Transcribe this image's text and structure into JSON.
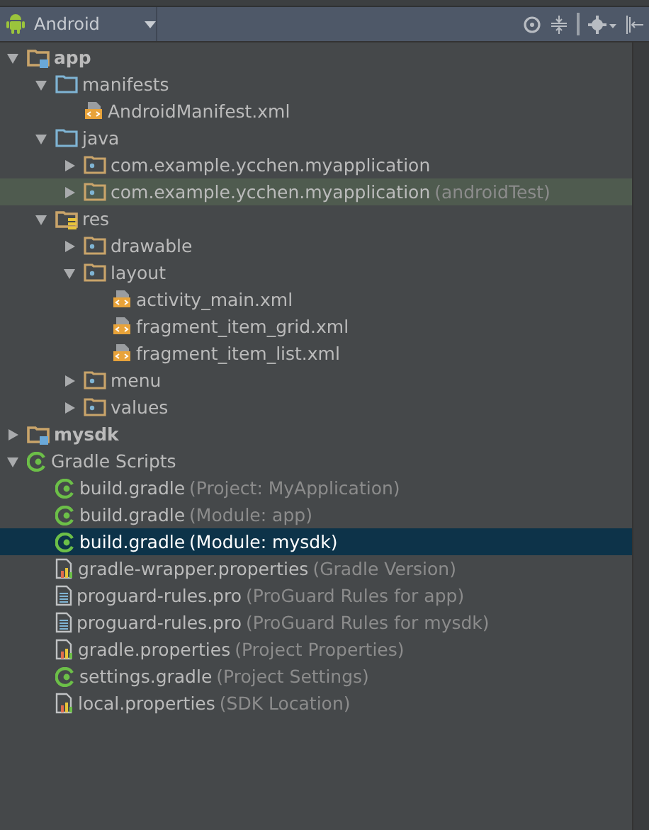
{
  "toolbar": {
    "view_label": "Android"
  },
  "tree": [
    {
      "kind": "module",
      "label": "app",
      "expanded": true,
      "selected": false,
      "highlighted": false,
      "children": [
        {
          "kind": "folder",
          "label": "manifests",
          "expanded": true,
          "selected": false,
          "highlighted": false,
          "children": [
            {
              "kind": "xml",
              "label": "AndroidManifest.xml",
              "selected": false,
              "highlighted": false
            }
          ]
        },
        {
          "kind": "folder",
          "label": "java",
          "expanded": true,
          "selected": false,
          "highlighted": false,
          "children": [
            {
              "kind": "package",
              "label": "com.example.ycchen.myapplication",
              "expanded": false,
              "selected": false,
              "highlighted": false
            },
            {
              "kind": "package",
              "label": "com.example.ycchen.myapplication",
              "note": "(androidTest)",
              "expanded": false,
              "selected": false,
              "highlighted": true
            }
          ]
        },
        {
          "kind": "resfolder",
          "label": "res",
          "expanded": true,
          "selected": false,
          "highlighted": false,
          "children": [
            {
              "kind": "package",
              "label": "drawable",
              "expanded": false,
              "selected": false,
              "highlighted": false
            },
            {
              "kind": "package",
              "label": "layout",
              "expanded": true,
              "selected": false,
              "highlighted": false,
              "children": [
                {
                  "kind": "xml",
                  "label": "activity_main.xml",
                  "selected": false,
                  "highlighted": false
                },
                {
                  "kind": "xml",
                  "label": "fragment_item_grid.xml",
                  "selected": false,
                  "highlighted": false
                },
                {
                  "kind": "xml",
                  "label": "fragment_item_list.xml",
                  "selected": false,
                  "highlighted": false
                }
              ]
            },
            {
              "kind": "package",
              "label": "menu",
              "expanded": false,
              "selected": false,
              "highlighted": false
            },
            {
              "kind": "package",
              "label": "values",
              "expanded": false,
              "selected": false,
              "highlighted": false
            }
          ]
        }
      ]
    },
    {
      "kind": "module",
      "label": "mysdk",
      "expanded": false,
      "selected": false,
      "highlighted": false
    },
    {
      "kind": "gradle",
      "label": "Gradle Scripts",
      "expanded": true,
      "selected": false,
      "highlighted": false,
      "children": [
        {
          "kind": "gradle",
          "label": "build.gradle",
          "note": "(Project: MyApplication)",
          "selected": false,
          "highlighted": false
        },
        {
          "kind": "gradle",
          "label": "build.gradle",
          "note": "(Module: app)",
          "selected": false,
          "highlighted": false
        },
        {
          "kind": "gradle",
          "label": "build.gradle",
          "note": "(Module: mysdk)",
          "selected": true,
          "highlighted": false
        },
        {
          "kind": "properties",
          "label": "gradle-wrapper.properties",
          "note": "(Gradle Version)",
          "selected": false,
          "highlighted": false
        },
        {
          "kind": "text",
          "label": "proguard-rules.pro",
          "note": "(ProGuard Rules for app)",
          "selected": false,
          "highlighted": false
        },
        {
          "kind": "text",
          "label": "proguard-rules.pro",
          "note": "(ProGuard Rules for mysdk)",
          "selected": false,
          "highlighted": false
        },
        {
          "kind": "properties",
          "label": "gradle.properties",
          "note": "(Project Properties)",
          "selected": false,
          "highlighted": false
        },
        {
          "kind": "gradle",
          "label": "settings.gradle",
          "note": "(Project Settings)",
          "selected": false,
          "highlighted": false
        },
        {
          "kind": "properties",
          "label": "local.properties",
          "note": "(SDK Location)",
          "selected": false,
          "highlighted": false
        }
      ]
    }
  ]
}
